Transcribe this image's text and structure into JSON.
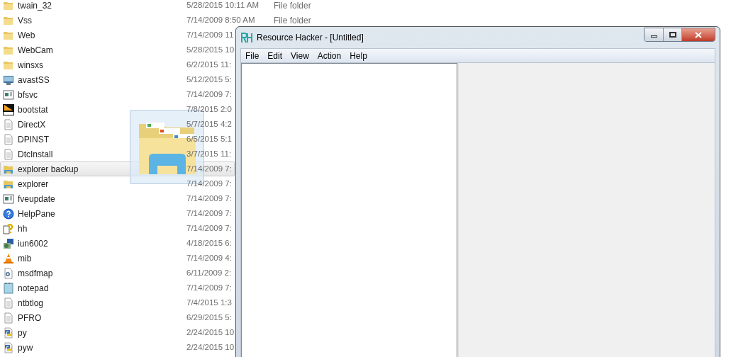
{
  "files": [
    {
      "name": "twain_32",
      "date": "5/28/2015 10:11 AM",
      "type": "File folder",
      "kind": "folder",
      "selected": false
    },
    {
      "name": "Vss",
      "date": "7/14/2009 8:50 AM",
      "type": "File folder",
      "kind": "folder",
      "selected": false
    },
    {
      "name": "Web",
      "date": "7/14/2009 11",
      "kind": "folder",
      "selected": false
    },
    {
      "name": "WebCam",
      "date": "5/28/2015 10",
      "kind": "folder",
      "selected": false
    },
    {
      "name": "winsxs",
      "date": "6/2/2015 11:",
      "kind": "folder",
      "selected": false
    },
    {
      "name": "avastSS",
      "date": "5/12/2015 5:",
      "kind": "monitor",
      "selected": false
    },
    {
      "name": "bfsvc",
      "date": "7/14/2009 7:",
      "kind": "app",
      "selected": false
    },
    {
      "name": "bootstat",
      "date": "7/8/2015 2:0",
      "kind": "dat",
      "selected": false
    },
    {
      "name": "DirectX",
      "date": "5/7/2015 4:2",
      "kind": "text",
      "selected": false
    },
    {
      "name": "DPINST",
      "date": "6/5/2015 5:1",
      "kind": "text",
      "selected": false
    },
    {
      "name": "DtcInstall",
      "date": "3/7/2015 11:",
      "kind": "text",
      "selected": false
    },
    {
      "name": "explorer backup",
      "date": "7/14/2009 7:",
      "kind": "explorer",
      "selected": true
    },
    {
      "name": "explorer",
      "date": "7/14/2009 7:",
      "kind": "explorer",
      "selected": false
    },
    {
      "name": "fveupdate",
      "date": "7/14/2009 7:",
      "kind": "app",
      "selected": false
    },
    {
      "name": "HelpPane",
      "date": "7/14/2009 7:",
      "kind": "help",
      "selected": false
    },
    {
      "name": "hh",
      "date": "7/14/2009 7:",
      "kind": "helpfile",
      "selected": false
    },
    {
      "name": "iun6002",
      "date": "4/18/2015 6:",
      "kind": "installer",
      "selected": false
    },
    {
      "name": "mib",
      "date": "7/14/2009 4:",
      "kind": "cone",
      "selected": false
    },
    {
      "name": "msdfmap",
      "date": "6/11/2009 2:",
      "kind": "config",
      "selected": false
    },
    {
      "name": "notepad",
      "date": "7/14/2009 7:",
      "kind": "notepad",
      "selected": false
    },
    {
      "name": "ntbtlog",
      "date": "7/4/2015 1:3",
      "kind": "text",
      "selected": false
    },
    {
      "name": "PFRO",
      "date": "6/29/2015 5:",
      "kind": "text",
      "selected": false
    },
    {
      "name": "py",
      "date": "2/24/2015 10",
      "kind": "python",
      "selected": false
    },
    {
      "name": "pyw",
      "date": "2/24/2015 10",
      "kind": "python",
      "selected": false
    }
  ],
  "window": {
    "title": "Resource Hacker - [Untitled]",
    "menu": [
      "File",
      "Edit",
      "View",
      "Action",
      "Help"
    ]
  }
}
